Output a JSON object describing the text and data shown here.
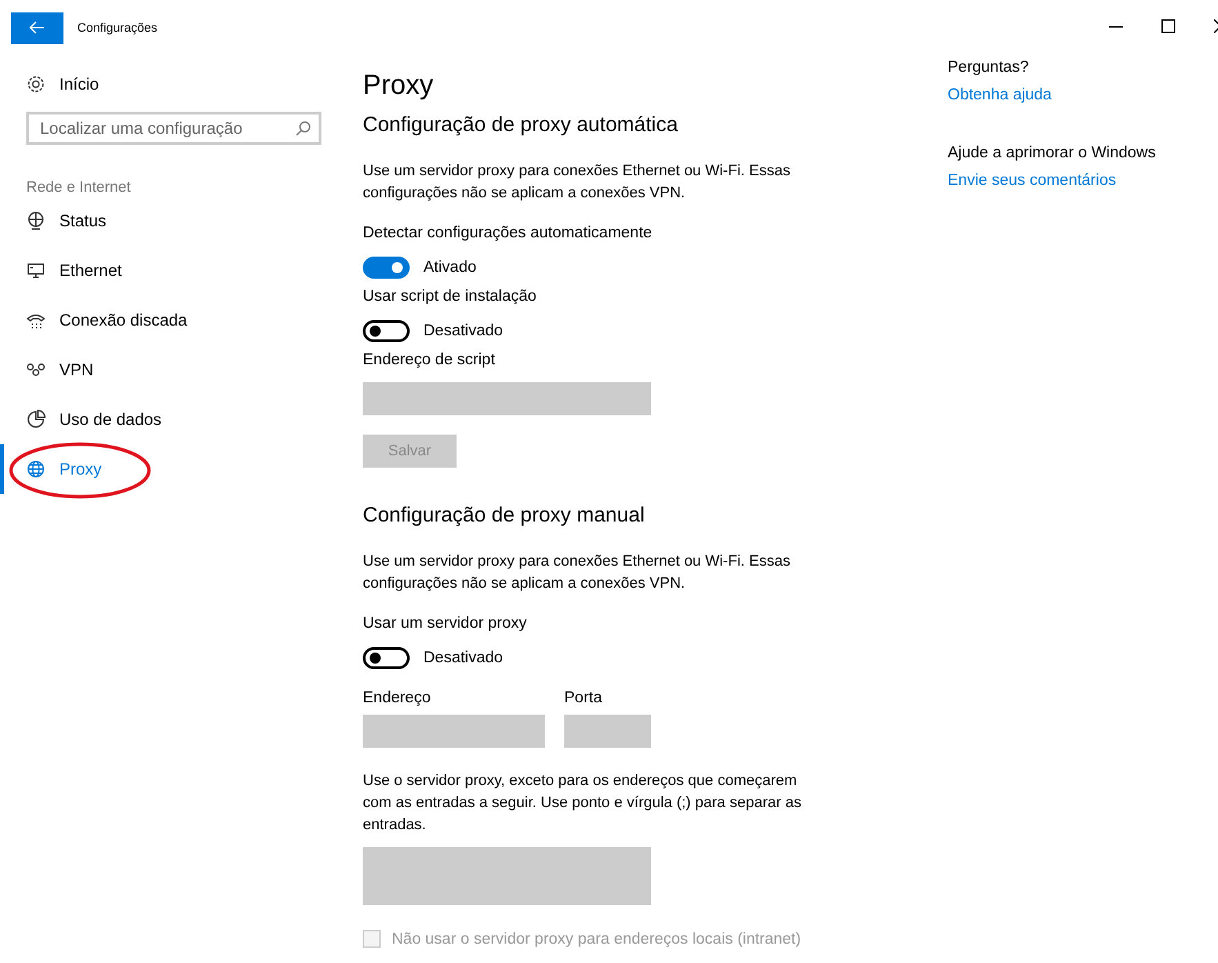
{
  "window": {
    "title": "Configurações"
  },
  "sidebar": {
    "home": "Início",
    "search": {
      "placeholder": "Localizar uma configuração"
    },
    "section": "Rede e Internet",
    "items": [
      {
        "label": "Status",
        "kind": "status",
        "selected": false
      },
      {
        "label": "Ethernet",
        "kind": "ethernet",
        "selected": false
      },
      {
        "label": "Conexão discada",
        "kind": "dialup",
        "selected": false
      },
      {
        "label": "VPN",
        "kind": "vpn",
        "selected": false
      },
      {
        "label": "Uso de dados",
        "kind": "data",
        "selected": false
      },
      {
        "label": "Proxy",
        "kind": "globe",
        "selected": true
      }
    ]
  },
  "annotation": {
    "kind": "ellipse",
    "color": "#e0141e"
  },
  "page": {
    "title": "Proxy",
    "auto": {
      "heading": "Configuração de proxy automática",
      "description": "Use um servidor proxy para conexões Ethernet ou Wi-Fi. Essas configurações não se aplicam a conexões VPN.",
      "toggles": [
        {
          "label": "Detectar configurações automaticamente",
          "on": true,
          "state": "Ativado"
        },
        {
          "label": "Usar script de instalação",
          "on": false,
          "state": "Desativado"
        }
      ],
      "script_label": "Endereço de script",
      "save": {
        "label": "Salvar",
        "disabled": true
      }
    },
    "manual": {
      "heading": "Configuração de proxy manual",
      "description": "Use um servidor proxy para conexões Ethernet ou Wi-Fi. Essas configurações não se aplicam a conexões VPN.",
      "toggle": {
        "label": "Usar um servidor proxy",
        "on": false,
        "state": "Desativado"
      },
      "address_label": "Endereço",
      "port_label": "Porta",
      "exceptions": "Use o servidor proxy, exceto para os endereços que começarem com as entradas a seguir. Use ponto e vírgula (;) para separar as entradas.",
      "local": {
        "label": "Não usar o servidor proxy para endereços locais (intranet)",
        "checked": false,
        "disabled": true
      }
    }
  },
  "help": [
    {
      "heading": "Perguntas?",
      "link": "Obtenha ajuda"
    },
    {
      "heading": "Ajude a aprimorar o Windows",
      "link": "Envie seus comentários"
    }
  ]
}
